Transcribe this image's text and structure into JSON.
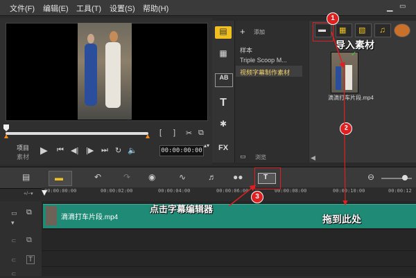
{
  "menu": {
    "items": [
      "文件(F)",
      "编辑(E)",
      "工具(T)",
      "设置(S)",
      "帮助(H)"
    ]
  },
  "preview": {
    "mode_labels": [
      "项目",
      "素材"
    ],
    "bracket_in": "[",
    "bracket_out": "]",
    "timecode": "00:00:00:00"
  },
  "library": {
    "add_label": "添加",
    "list": [
      "样本",
      "Triple Scoop M...",
      "视频字幕制作素材"
    ],
    "selected_index": 2,
    "browse_label": "浏览",
    "clip_name": "滴滴打车片段.mp4"
  },
  "timeline": {
    "ruler_ticks": [
      "00:00:00:00",
      "00:00:02:00",
      "00:00:04:00",
      "00:00:06:00",
      "00:00:08:00",
      "00:00:10:00",
      "00:00:12"
    ],
    "clip_label": "滴滴打车片段.mp4"
  },
  "annotations": {
    "badge_1": "1",
    "badge_2": "2",
    "badge_3": "3",
    "import_text": "导入素材",
    "drag_text": "拖到此处",
    "title_editor_text": "点击字幕编辑器"
  },
  "colors": {
    "annotation_red": "#e02020",
    "clip_green": "#1f8a76",
    "accent_orange": "#f28a1f"
  }
}
